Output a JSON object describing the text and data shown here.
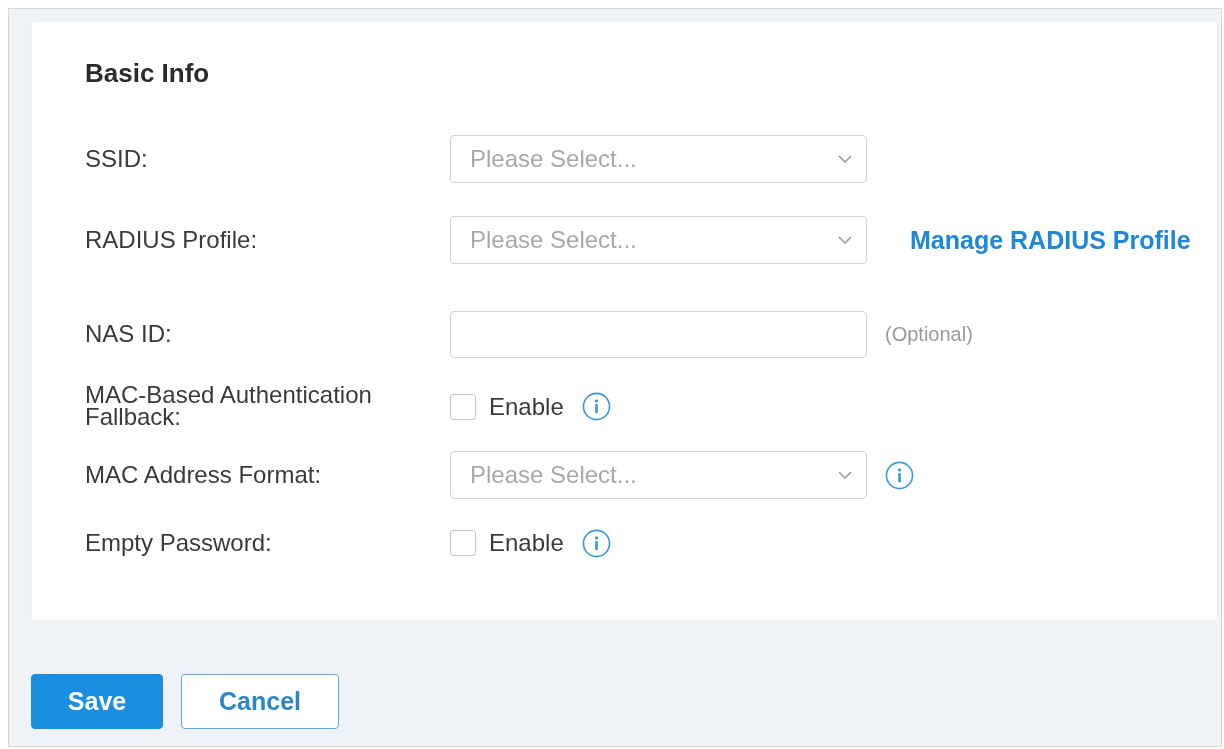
{
  "section": {
    "title": "Basic Info"
  },
  "fields": [
    {
      "kind": "select",
      "label": "SSID:",
      "placeholder": "Please Select..."
    },
    {
      "kind": "select",
      "label": "RADIUS Profile:",
      "placeholder": "Please Select...",
      "link": "Manage RADIUS Profile"
    },
    {
      "kind": "text",
      "label": "NAS ID:",
      "hint": "(Optional)"
    },
    {
      "kind": "checkbox",
      "label": "MAC-Based Authentication Fallback:",
      "option": "Enable",
      "checked": false,
      "info": true
    },
    {
      "kind": "select",
      "label": "MAC Address Format:",
      "placeholder": "Please Select...",
      "info": true
    },
    {
      "kind": "checkbox",
      "label": "Empty Password:",
      "option": "Enable",
      "checked": false,
      "info": true
    }
  ],
  "buttons": [
    {
      "kind": "primary",
      "label": "Save"
    },
    {
      "kind": "secondary",
      "label": "Cancel"
    }
  ]
}
